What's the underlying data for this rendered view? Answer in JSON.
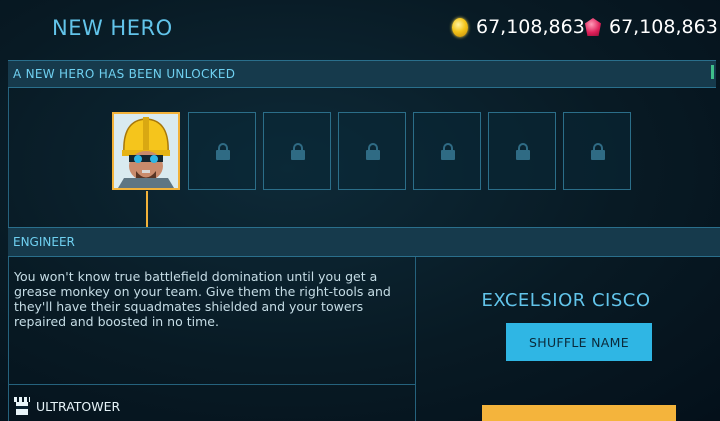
{
  "header": {
    "title": "NEW HERO",
    "coins": "67,108,863",
    "gems": "67,108,863"
  },
  "unlock_banner": "A NEW HERO HAS BEEN UNLOCKED",
  "hero_slots": {
    "total": 7,
    "unlocked": 1
  },
  "hero": {
    "class": "ENGINEER",
    "description": "You won't know true battlefield domination until you get a grease monkey on your team. Give them the right-tools and they'll have their squadmates shielded and your towers repaired and boosted in no time.",
    "name": "EXCELSIOR CISCO",
    "shuffle_label": "SHUFFLE NAME"
  },
  "ultratower": {
    "label": "ULTRATOWER"
  },
  "colors": {
    "accent": "#62c4ea",
    "button": "#2fb6e4",
    "highlight": "#f2b23a",
    "confirm_button": "#f4b43c"
  }
}
